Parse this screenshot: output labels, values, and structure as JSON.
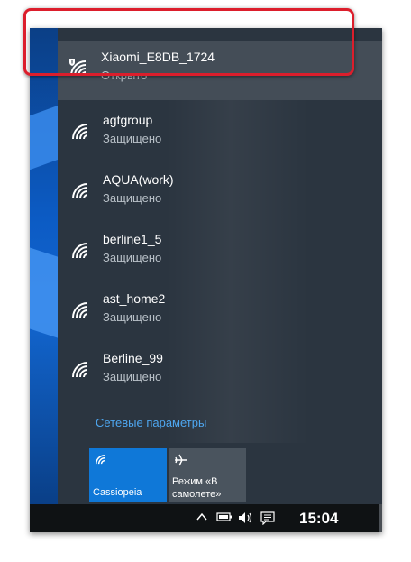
{
  "networks": [
    {
      "name": "Xiaomi_E8DB_1724",
      "status": "Открыто",
      "shield": true
    },
    {
      "name": "agtgroup",
      "status": "Защищено",
      "shield": false
    },
    {
      "name": "AQUA(work)",
      "status": "Защищено",
      "shield": false
    },
    {
      "name": "berline1_5",
      "status": "Защищено",
      "shield": false
    },
    {
      "name": "ast_home2",
      "status": "Защищено",
      "shield": false
    },
    {
      "name": "Berline_99",
      "status": "Защищено",
      "shield": false
    }
  ],
  "settings_link": "Сетевые параметры",
  "quick_actions": {
    "wifi_label": "Cassiopeia",
    "airplane_label": "Режим «В самолете»"
  },
  "taskbar": {
    "clock": "15:04",
    "icons": [
      "chevron-up-icon",
      "battery-icon",
      "volume-icon",
      "action-center-icon"
    ]
  },
  "colors": {
    "highlight": "#dc1e2c",
    "accent": "#0f78d8",
    "link": "#4ea6ef"
  }
}
